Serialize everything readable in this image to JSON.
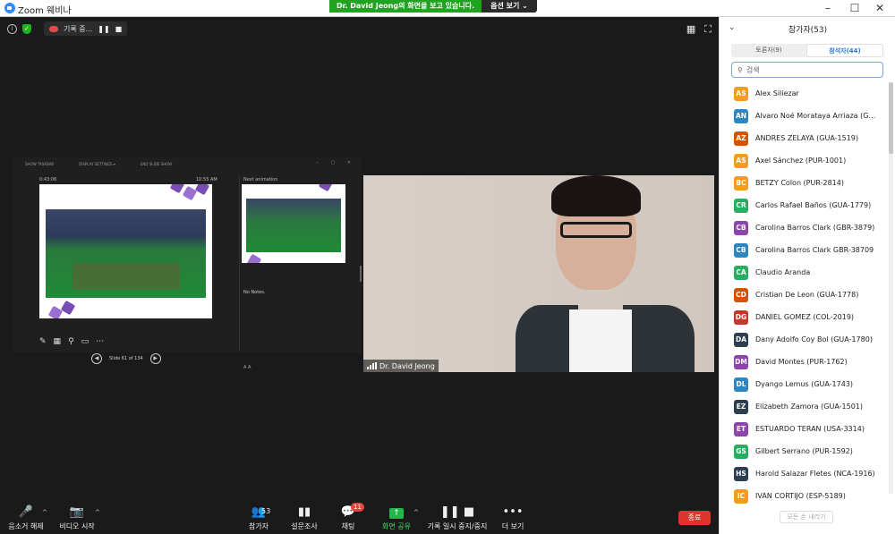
{
  "window": {
    "title": "Zoom 웨비나",
    "minimize": "–",
    "maximize": "☐",
    "close": "✕"
  },
  "share_banner": {
    "message": "Dr. David Jeong의 화면을 보고 있습니다.",
    "options": "옵션 보기 ⌄"
  },
  "recording": {
    "label": "기록 중...",
    "pause": "❚❚",
    "stop": "■"
  },
  "top_icons": {
    "info": "i",
    "shield": "✓",
    "gallery": "▦",
    "fullscreen": "⛶"
  },
  "slides": {
    "toolbar": [
      "SHOW TASKBAR",
      "DISPLAY SETTINGS ▾",
      "END SLIDE SHOW"
    ],
    "window_controls": "– ▢ ✕",
    "elapsed": "0:43:06",
    "clock": "10:55 AM",
    "next_label": "Next animation",
    "notes": "No Notes.",
    "counter": "Slide 61 of 134",
    "prev": "◀",
    "next": "▶",
    "zoom_tools": "A  A",
    "tools": {
      "pen": "✎",
      "grid": "▦",
      "zoom": "⚲",
      "screen": "▭",
      "more": "⋯"
    }
  },
  "video": {
    "name": "Dr. David Jeong"
  },
  "toolbar": {
    "mute": {
      "label": "음소거 해제",
      "icon": "🎤"
    },
    "video": {
      "label": "비디오 시작",
      "icon": "📷"
    },
    "participants": {
      "label": "참가자",
      "icon": "👥",
      "count": "53"
    },
    "polls": {
      "label": "설문조사",
      "icon": "▮▮"
    },
    "chat": {
      "label": "채팅",
      "icon": "💬",
      "badge": "11"
    },
    "share": {
      "label": "화면 공유",
      "icon": "↑"
    },
    "recording": {
      "label": "기록 일시 중지/중지",
      "pause": "❚❚",
      "stop": "■"
    },
    "more": {
      "label": "더 보기",
      "icon": "•••"
    },
    "caret": "^",
    "end": "종료"
  },
  "panel": {
    "title": "참가자(53)",
    "collapse": "⌄",
    "tabs": [
      "토론자(9)",
      "참석자(44)"
    ],
    "search_icon": "⚲",
    "search_placeholder": "검색",
    "participants": [
      {
        "initials": "AS",
        "name": "Alex Siliezar",
        "color": "#f39c1f"
      },
      {
        "initials": "AN",
        "name": "Alvaro Noé Morataya Arriaza (GUA-...",
        "color": "#2e86c1"
      },
      {
        "initials": "AZ",
        "name": "ANDRES ZELAYA (GUA-1519)",
        "color": "#d35400"
      },
      {
        "initials": "AS",
        "name": "Axel Sánchez (PUR-1001)",
        "color": "#f39c1f"
      },
      {
        "initials": "BC",
        "name": "BETZY Colon (PUR-2814)",
        "color": "#f39c1f"
      },
      {
        "initials": "CR",
        "name": "Carlos Rafael Baños (GUA-1779)",
        "color": "#27ae60"
      },
      {
        "initials": "CB",
        "name": "Carolina Barros Clark (GBR-3879)",
        "color": "#8e44ad"
      },
      {
        "initials": "CB",
        "name": "Carolina Barros Clark GBR-38709",
        "color": "#2e86c1"
      },
      {
        "initials": "CA",
        "name": "Claudio Aranda",
        "color": "#27ae60"
      },
      {
        "initials": "CD",
        "name": "Cristian De Leon (GUA-1778)",
        "color": "#d35400"
      },
      {
        "initials": "DG",
        "name": "DANIEL GOMEZ (COL-2019)",
        "color": "#c0392b"
      },
      {
        "initials": "DA",
        "name": "Dany Adolfo Coy Bol (GUA-1780)",
        "color": "#2c3e50"
      },
      {
        "initials": "DM",
        "name": "David Montes (PUR-1762)",
        "color": "#8e44ad"
      },
      {
        "initials": "DL",
        "name": "Dyango Lemus (GUA-1743)",
        "color": "#2e86c1"
      },
      {
        "initials": "EZ",
        "name": "Elizabeth Zamora (GUA-1501)",
        "color": "#2c3e50"
      },
      {
        "initials": "ET",
        "name": "ESTUARDO TERAN (USA-3314)",
        "color": "#8e44ad"
      },
      {
        "initials": "GS",
        "name": "Gilbert Serrano (PUR-1592)",
        "color": "#27ae60"
      },
      {
        "initials": "HS",
        "name": "Harold Salazar Fletes (NCA-1916)",
        "color": "#2c3e50"
      },
      {
        "initials": "IC",
        "name": "IVÁN CORTIJO (ESP-5189)",
        "color": "#f39c1f"
      }
    ],
    "raise_hand": "모든 손 내리기"
  }
}
